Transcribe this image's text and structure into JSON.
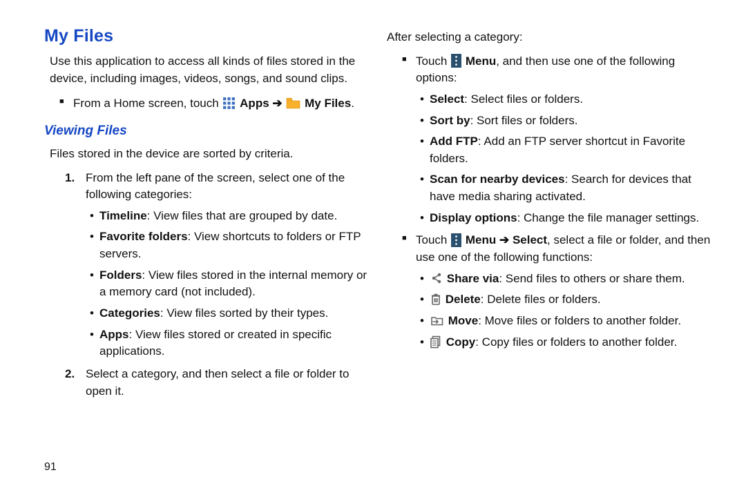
{
  "title": "My Files",
  "intro": "Use this application to access all kinds of files stored in the device, including images, videos, songs, and sound clips.",
  "home_instruction": {
    "prefix": "From a Home screen, touch ",
    "apps_label": "Apps",
    "arrow": "➔",
    "myfiles_label": "My Files",
    "period": "."
  },
  "subhead": "Viewing Files",
  "sorted_text": "Files stored in the device are sorted by criteria.",
  "steps": [
    {
      "num": "1.",
      "text": "From the left pane of the screen, select one of the following categories:",
      "bullets": [
        {
          "bold": "Timeline",
          "rest": ": View files that are grouped by date."
        },
        {
          "bold": "Favorite folders",
          "rest": ": View shortcuts to folders or FTP servers."
        },
        {
          "bold": "Folders",
          "rest": ": View files stored in the internal memory or a memory card (not included)."
        },
        {
          "bold": "Categories",
          "rest": ": View files sorted by their types."
        },
        {
          "bold": "Apps",
          "rest": ": View files stored or created in specific applications."
        }
      ]
    },
    {
      "num": "2.",
      "text": "Select a category, and then select a file or folder to open it."
    }
  ],
  "after_category": "After selecting a category:",
  "menu_instruction": {
    "touch": "Touch ",
    "menu_label": "Menu",
    "rest": ", and then use one of the following options:"
  },
  "menu_options": [
    {
      "bold": "Select",
      "rest": ": Select files or folders."
    },
    {
      "bold": "Sort by",
      "rest": ": Sort files or folders."
    },
    {
      "bold": "Add FTP",
      "rest": ": Add an FTP server shortcut in Favorite folders."
    },
    {
      "bold": "Scan for nearby devices",
      "rest": ": Search for devices that have media sharing activated."
    },
    {
      "bold": "Display options",
      "rest": ": Change the file manager settings."
    }
  ],
  "select_instruction": {
    "touch": "Touch ",
    "menu_label": "Menu",
    "arrow": "➔",
    "select_label": "Select",
    "rest": ", select a file or folder, and then use one of the following functions:"
  },
  "actions": [
    {
      "bold": "Share via",
      "rest": ": Send files to others or share them."
    },
    {
      "bold": "Delete",
      "rest": ": Delete files or folders."
    },
    {
      "bold": "Move",
      "rest": ": Move files or folders to another folder."
    },
    {
      "bold": "Copy",
      "rest": ": Copy files or folders to another folder."
    }
  ],
  "page_number": "91"
}
